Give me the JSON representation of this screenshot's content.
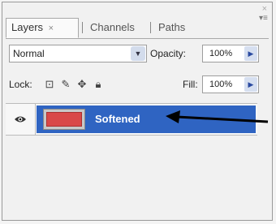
{
  "panel": {
    "tabs": [
      {
        "label": "Layers",
        "close": "×"
      },
      {
        "label": "Channels"
      },
      {
        "label": "Paths"
      }
    ],
    "panel_close": "×",
    "menu_icon": "panel-menu-icon"
  },
  "controls": {
    "blend_mode": "Normal",
    "opacity_label": "Opacity:",
    "opacity_value": "100%",
    "lock_label": "Lock:",
    "fill_label": "Fill:",
    "fill_value": "100%"
  },
  "layers": [
    {
      "name": "Softened",
      "selected": true,
      "visible": true
    }
  ],
  "colors": {
    "selection": "#2f64c2",
    "thumbnail": "#d94848"
  }
}
